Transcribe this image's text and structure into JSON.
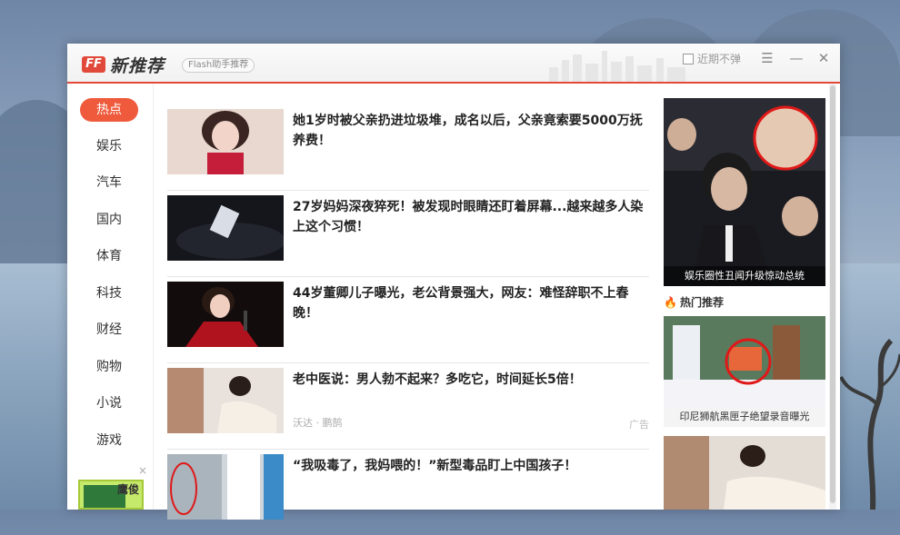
{
  "window": {
    "logo_badge": "FF",
    "logo_text": "新推荐",
    "logo_sub": "Flash助手推荐",
    "no_popup_label": "近期不弹",
    "menu_icon": "menu-icon",
    "minimize_icon": "minimize-icon",
    "close_icon": "close-icon"
  },
  "categories": [
    "热点",
    "娱乐",
    "汽车",
    "国内",
    "体育",
    "科技",
    "财经",
    "购物",
    "小说",
    "游戏"
  ],
  "active_category": "热点",
  "sidebar_ad": {
    "close_label": "×",
    "text": "鹰俊"
  },
  "feed": [
    {
      "title": "她1岁时被父亲扔进垃圾堆，成名以后，父亲竟索要5000万抚养费！"
    },
    {
      "title": "27岁妈妈深夜猝死！被发现时眼睛还盯着屏幕...越来越多人染上这个习惯！"
    },
    {
      "title": "44岁董卿儿子曝光，老公背景强大，网友：难怪辞职不上春晚！"
    },
    {
      "title": "老中医说：男人勃不起来？多吃它，时间延长5倍！",
      "meta": "沃达 · 鹏鹄",
      "ad_label": "广告"
    },
    {
      "title": "“我吸毒了，我妈喂的！”新型毒品盯上中国孩子！"
    }
  ],
  "right": {
    "big_caption": "娱乐圈性丑闻升级惊动总统",
    "hot_header": "热门推荐",
    "item2_caption": "印尼狮航黑匣子绝望录音曝光"
  },
  "colors": {
    "accent": "#e14a3a",
    "active_tab": "#f05a3c"
  }
}
